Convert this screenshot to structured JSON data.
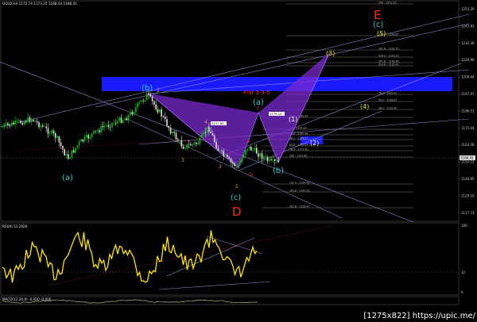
{
  "header": {
    "symbol_info": "GOLD,H4  1172.74  1173.25  1168.03  1168.41",
    "rsi_label": "RSI(8) 51.2026",
    "lower_label": "MACD(12,26,9) -0.000 -0.000"
  },
  "waves": {
    "e_label": "E",
    "d_label": "D",
    "b_top": "(b)",
    "a_left": "(a)",
    "a_mid": "(a)",
    "c_teal_low": "(c)",
    "c_teal_top": "(c)",
    "b_teal": "(b)",
    "y1": "(1)",
    "y2": "(2)",
    "y3": "(3)",
    "y4": "(4)",
    "y5": "(5)",
    "flat": "Flat 3-3-5",
    "n2": "2",
    "n3": "3",
    "n4": "4",
    "n5": "5",
    "na": "a",
    "nb": "b",
    "nc": "c",
    "tag1": "1157.80",
    "tag2": "1179.14",
    "cur_price": "1168.41"
  },
  "price_axis": [
    "1255.29",
    "1243.83",
    "1232.36",
    "1220.90",
    "1209.44",
    "1197.97",
    "1186.51",
    "1175.04",
    "1163.58",
    "1152.12",
    "1140.65",
    "1129.19",
    "1117.73"
  ],
  "rsi_axis": [
    "100",
    "32",
    "0"
  ],
  "fib_levels": [
    "100 - 1251.02",
    "138.2 - 1239.67",
    "161.8 - 1229.72",
    "200.0 - 1223.23",
    "261.8 - 1218.48",
    "323.6 - 1210.41",
    "76.4 - 1202.01",
    "50.0 - 1196.87",
    "38.2 - 1191.42",
    "23.6 - 1185.43",
    "0.0 - 1174.23",
    "23.6 - 1167.98",
    "38.2 - 1164.27",
    "61.8 - 1160.07",
    "76.4 - 1157.30",
    "100 - 1151.85",
    "127.2 - 1147.42",
    "161.8 - 1141.52",
    "261.8 - 1126.47"
  ],
  "watermark": "[1275x822] https://upic.me/",
  "colors": {
    "bull": "#00c800",
    "bear": "#e0e0e0",
    "rsi": "#ffe600",
    "blue_zone": "#1a1aff",
    "purple": "#8a2be2",
    "teal": "#33cccc",
    "yellow": "#e6e600",
    "red": "#ff2a00"
  }
}
